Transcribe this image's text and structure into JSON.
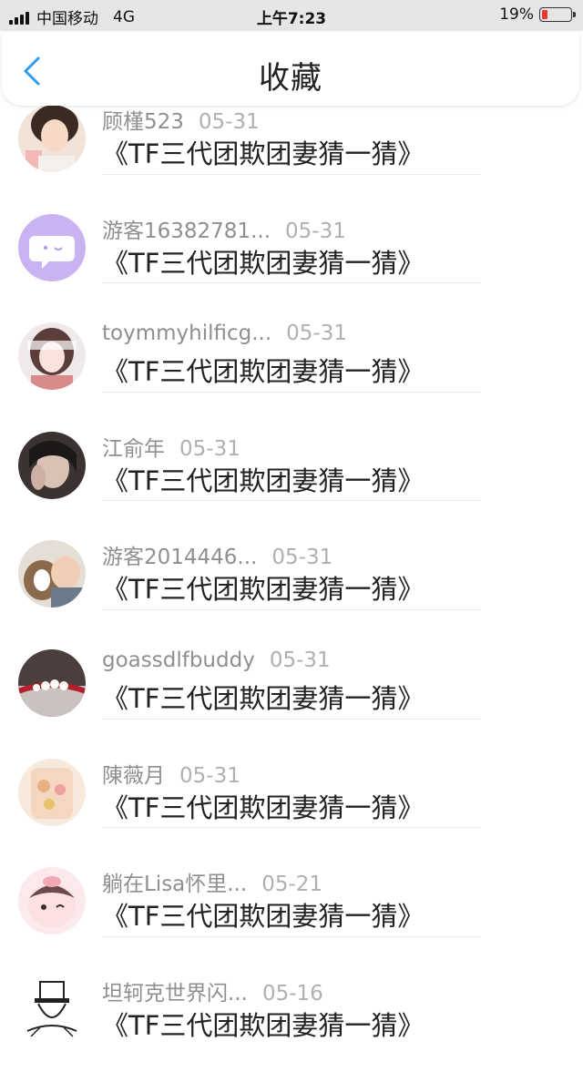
{
  "status_bar": {
    "carrier": "中国移动",
    "network": "4G",
    "time": "上午7:23",
    "battery": "19%",
    "battery_level": 0.19,
    "battery_color": "#e53935"
  },
  "header": {
    "title": "收藏",
    "back_icon": "chevron-left-icon",
    "accent_color": "#2d9bf0"
  },
  "items": [
    {
      "user": "顾槿523",
      "date": "05-31",
      "title": "《TF三代团欺团妻猜一猜》"
    },
    {
      "user": "游客16382781...",
      "date": "05-31",
      "title": "《TF三代团欺团妻猜一猜》"
    },
    {
      "user": "toymmyhilficg...",
      "date": "05-31",
      "title": "《TF三代团欺团妻猜一猜》"
    },
    {
      "user": "江俞年",
      "date": "05-31",
      "title": "《TF三代团欺团妻猜一猜》"
    },
    {
      "user": "游客2014446...",
      "date": "05-31",
      "title": "《TF三代团欺团妻猜一猜》"
    },
    {
      "user": "goassdlfbuddy",
      "date": "05-31",
      "title": "《TF三代团欺团妻猜一猜》"
    },
    {
      "user": "陳薇月",
      "date": "05-31",
      "title": "《TF三代团欺团妻猜一猜》"
    },
    {
      "user": "躺在Lisa怀里...",
      "date": "05-21",
      "title": "《TF三代团欺团妻猜一猜》"
    },
    {
      "user": "坦轲克世界闪...",
      "date": "05-16",
      "title": "《TF三代团欺团妻猜一猜》"
    }
  ]
}
